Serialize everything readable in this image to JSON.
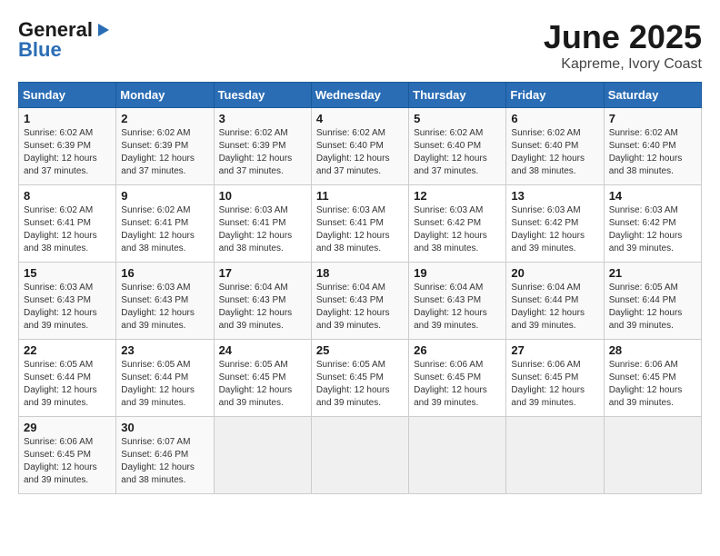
{
  "header": {
    "logo_general": "General",
    "logo_blue": "Blue",
    "title": "June 2025",
    "subtitle": "Kapreme, Ivory Coast"
  },
  "days_of_week": [
    "Sunday",
    "Monday",
    "Tuesday",
    "Wednesday",
    "Thursday",
    "Friday",
    "Saturday"
  ],
  "weeks": [
    [
      {
        "day": "1",
        "info": "Sunrise: 6:02 AM\nSunset: 6:39 PM\nDaylight: 12 hours\nand 37 minutes."
      },
      {
        "day": "2",
        "info": "Sunrise: 6:02 AM\nSunset: 6:39 PM\nDaylight: 12 hours\nand 37 minutes."
      },
      {
        "day": "3",
        "info": "Sunrise: 6:02 AM\nSunset: 6:39 PM\nDaylight: 12 hours\nand 37 minutes."
      },
      {
        "day": "4",
        "info": "Sunrise: 6:02 AM\nSunset: 6:40 PM\nDaylight: 12 hours\nand 37 minutes."
      },
      {
        "day": "5",
        "info": "Sunrise: 6:02 AM\nSunset: 6:40 PM\nDaylight: 12 hours\nand 37 minutes."
      },
      {
        "day": "6",
        "info": "Sunrise: 6:02 AM\nSunset: 6:40 PM\nDaylight: 12 hours\nand 38 minutes."
      },
      {
        "day": "7",
        "info": "Sunrise: 6:02 AM\nSunset: 6:40 PM\nDaylight: 12 hours\nand 38 minutes."
      }
    ],
    [
      {
        "day": "8",
        "info": "Sunrise: 6:02 AM\nSunset: 6:41 PM\nDaylight: 12 hours\nand 38 minutes."
      },
      {
        "day": "9",
        "info": "Sunrise: 6:02 AM\nSunset: 6:41 PM\nDaylight: 12 hours\nand 38 minutes."
      },
      {
        "day": "10",
        "info": "Sunrise: 6:03 AM\nSunset: 6:41 PM\nDaylight: 12 hours\nand 38 minutes."
      },
      {
        "day": "11",
        "info": "Sunrise: 6:03 AM\nSunset: 6:41 PM\nDaylight: 12 hours\nand 38 minutes."
      },
      {
        "day": "12",
        "info": "Sunrise: 6:03 AM\nSunset: 6:42 PM\nDaylight: 12 hours\nand 38 minutes."
      },
      {
        "day": "13",
        "info": "Sunrise: 6:03 AM\nSunset: 6:42 PM\nDaylight: 12 hours\nand 39 minutes."
      },
      {
        "day": "14",
        "info": "Sunrise: 6:03 AM\nSunset: 6:42 PM\nDaylight: 12 hours\nand 39 minutes."
      }
    ],
    [
      {
        "day": "15",
        "info": "Sunrise: 6:03 AM\nSunset: 6:43 PM\nDaylight: 12 hours\nand 39 minutes."
      },
      {
        "day": "16",
        "info": "Sunrise: 6:03 AM\nSunset: 6:43 PM\nDaylight: 12 hours\nand 39 minutes."
      },
      {
        "day": "17",
        "info": "Sunrise: 6:04 AM\nSunset: 6:43 PM\nDaylight: 12 hours\nand 39 minutes."
      },
      {
        "day": "18",
        "info": "Sunrise: 6:04 AM\nSunset: 6:43 PM\nDaylight: 12 hours\nand 39 minutes."
      },
      {
        "day": "19",
        "info": "Sunrise: 6:04 AM\nSunset: 6:43 PM\nDaylight: 12 hours\nand 39 minutes."
      },
      {
        "day": "20",
        "info": "Sunrise: 6:04 AM\nSunset: 6:44 PM\nDaylight: 12 hours\nand 39 minutes."
      },
      {
        "day": "21",
        "info": "Sunrise: 6:05 AM\nSunset: 6:44 PM\nDaylight: 12 hours\nand 39 minutes."
      }
    ],
    [
      {
        "day": "22",
        "info": "Sunrise: 6:05 AM\nSunset: 6:44 PM\nDaylight: 12 hours\nand 39 minutes."
      },
      {
        "day": "23",
        "info": "Sunrise: 6:05 AM\nSunset: 6:44 PM\nDaylight: 12 hours\nand 39 minutes."
      },
      {
        "day": "24",
        "info": "Sunrise: 6:05 AM\nSunset: 6:45 PM\nDaylight: 12 hours\nand 39 minutes."
      },
      {
        "day": "25",
        "info": "Sunrise: 6:05 AM\nSunset: 6:45 PM\nDaylight: 12 hours\nand 39 minutes."
      },
      {
        "day": "26",
        "info": "Sunrise: 6:06 AM\nSunset: 6:45 PM\nDaylight: 12 hours\nand 39 minutes."
      },
      {
        "day": "27",
        "info": "Sunrise: 6:06 AM\nSunset: 6:45 PM\nDaylight: 12 hours\nand 39 minutes."
      },
      {
        "day": "28",
        "info": "Sunrise: 6:06 AM\nSunset: 6:45 PM\nDaylight: 12 hours\nand 39 minutes."
      }
    ],
    [
      {
        "day": "29",
        "info": "Sunrise: 6:06 AM\nSunset: 6:45 PM\nDaylight: 12 hours\nand 39 minutes."
      },
      {
        "day": "30",
        "info": "Sunrise: 6:07 AM\nSunset: 6:46 PM\nDaylight: 12 hours\nand 38 minutes."
      },
      {
        "day": "",
        "info": ""
      },
      {
        "day": "",
        "info": ""
      },
      {
        "day": "",
        "info": ""
      },
      {
        "day": "",
        "info": ""
      },
      {
        "day": "",
        "info": ""
      }
    ]
  ]
}
